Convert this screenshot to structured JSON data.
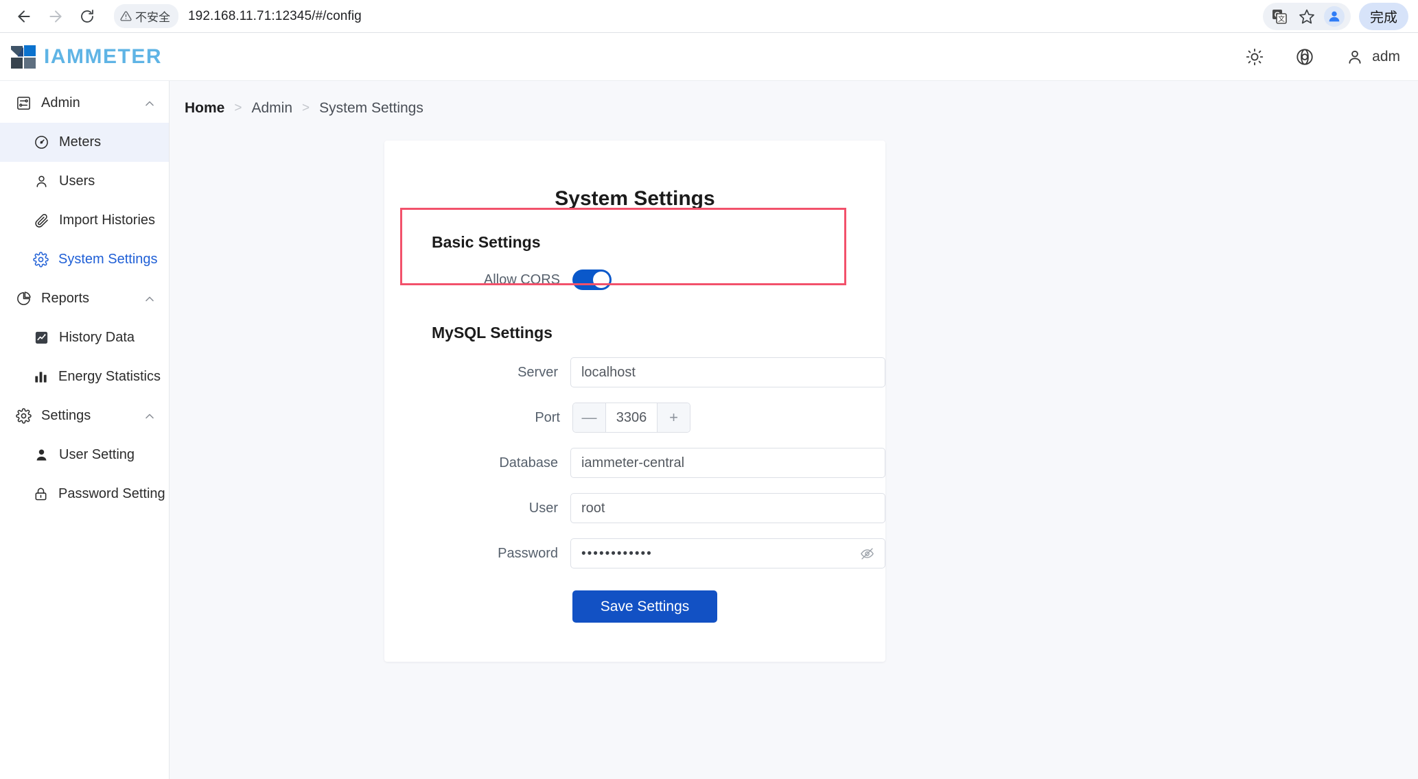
{
  "browser": {
    "back_icon": "arrow-left-icon",
    "forward_icon": "arrow-right-icon",
    "reload_icon": "reload-icon",
    "security_label": "不安全",
    "security_icon": "warning-triangle-icon",
    "url": "192.168.11.71:12345/#/config",
    "translate_icon": "translate-icon",
    "bookmark_icon": "star-icon",
    "profile_icon": "user-avatar-icon",
    "done_label": "完成"
  },
  "header": {
    "logo_text": "IAMMETER",
    "theme_icon": "sun-icon",
    "language_icon": "globe-icon",
    "user_icon": "user-icon",
    "username": "adm"
  },
  "sidebar": {
    "groups": [
      {
        "label": "Admin",
        "icon": "admin-panel-icon",
        "expanded": true,
        "items": [
          {
            "label": "Meters",
            "icon": "gauge-icon",
            "active": true,
            "current": false
          },
          {
            "label": "Users",
            "icon": "user-outline-icon",
            "active": false,
            "current": false
          },
          {
            "label": "Import Histories",
            "icon": "paperclip-icon",
            "active": false,
            "current": false
          },
          {
            "label": "System Settings",
            "icon": "gear-icon",
            "active": false,
            "current": true
          }
        ]
      },
      {
        "label": "Reports",
        "icon": "pie-chart-icon",
        "expanded": true,
        "items": [
          {
            "label": "History Data",
            "icon": "line-chart-icon",
            "active": false,
            "current": false
          },
          {
            "label": "Energy Statistics",
            "icon": "bar-chart-icon",
            "active": false,
            "current": false
          }
        ]
      },
      {
        "label": "Settings",
        "icon": "gear-icon",
        "expanded": true,
        "items": [
          {
            "label": "User Setting",
            "icon": "person-filled-icon",
            "active": false,
            "current": false
          },
          {
            "label": "Password Setting",
            "icon": "lock-icon",
            "active": false,
            "current": false
          }
        ]
      }
    ]
  },
  "breadcrumb": {
    "home": "Home",
    "separator": ">",
    "section": "Admin",
    "current": "System Settings"
  },
  "main": {
    "title": "System Settings",
    "basic_section_title": "Basic Settings",
    "allow_cors_label": "Allow CORS",
    "allow_cors_value": "on",
    "mysql_section_title": "MySQL Settings",
    "fields": {
      "server_label": "Server",
      "server_value": "localhost",
      "port_label": "Port",
      "port_value": "3306",
      "port_minus": "—",
      "port_plus": "+",
      "database_label": "Database",
      "database_value": "iammeter-central",
      "user_label": "User",
      "user_value": "root",
      "password_label": "Password",
      "password_value": "••••••••••••",
      "password_eye_icon": "eye-off-icon"
    },
    "save_label": "Save Settings"
  },
  "annotation": {
    "color": "#f2516b",
    "target": "basic-settings-allow-cors"
  },
  "colors": {
    "accent": "#1251c4",
    "toggle_on": "#0a58ca",
    "active_nav_bg": "#eef2fb",
    "active_nav_text": "#1f5fd6",
    "logo_blue": "#5fb4e5",
    "annotation_red": "#f2516b"
  }
}
